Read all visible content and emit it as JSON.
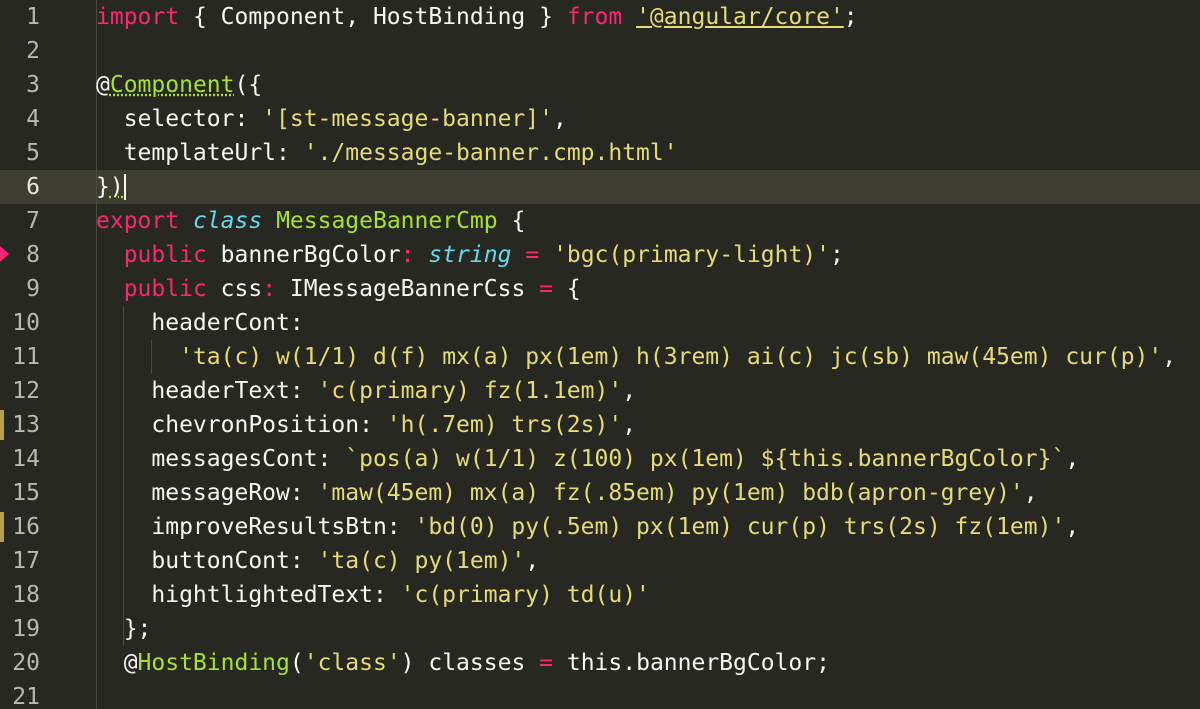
{
  "editor": {
    "colors": {
      "background": "#272822",
      "foreground": "#f8f8f2",
      "keyword": "#f92672",
      "function": "#a6e22e",
      "type": "#66d9ef",
      "string": "#e6db74",
      "gutter_number": "#b8b8b0",
      "current_line": "#3e3d32"
    },
    "current_line": 6,
    "modified_lines": [
      13,
      16
    ],
    "line_numbers": [
      "1",
      "2",
      "3",
      "4",
      "5",
      "6",
      "7",
      "8",
      "9",
      "10",
      "11",
      "12",
      "13",
      "14",
      "15",
      "16",
      "17",
      "18",
      "19",
      "20",
      "21"
    ],
    "lines": [
      {
        "tokens": [
          {
            "t": "import",
            "c": "kw"
          },
          {
            "t": " { Component, HostBinding } ",
            "c": ""
          },
          {
            "t": "from",
            "c": "kw"
          },
          {
            "t": " ",
            "c": ""
          },
          {
            "t": "'@angular/core'",
            "c": "st uline"
          },
          {
            "t": ";",
            "c": ""
          }
        ]
      },
      {
        "tokens": []
      },
      {
        "tokens": [
          {
            "t": "@",
            "c": ""
          },
          {
            "t": "Component",
            "c": "fn squiggle"
          },
          {
            "t": "({",
            "c": ""
          }
        ]
      },
      {
        "tokens": [
          {
            "t": "  selector: ",
            "c": ""
          },
          {
            "t": "'[st-message-banner]'",
            "c": "st"
          },
          {
            "t": ",",
            "c": ""
          }
        ]
      },
      {
        "tokens": [
          {
            "t": "  templateUrl: ",
            "c": ""
          },
          {
            "t": "'./message-banner.cmp.html'",
            "c": "st"
          }
        ]
      },
      {
        "tokens": [
          {
            "t": "}",
            "c": ""
          },
          {
            "t": ")",
            "c": "squiggle"
          }
        ]
      },
      {
        "tokens": [
          {
            "t": "export",
            "c": "kw"
          },
          {
            "t": " ",
            "c": ""
          },
          {
            "t": "class",
            "c": "ty"
          },
          {
            "t": " ",
            "c": ""
          },
          {
            "t": "MessageBannerCmp",
            "c": "fn"
          },
          {
            "t": " {",
            "c": ""
          }
        ]
      },
      {
        "tokens": [
          {
            "t": "  ",
            "c": ""
          },
          {
            "t": "public",
            "c": "kw"
          },
          {
            "t": " bannerBgColor",
            "c": ""
          },
          {
            "t": ":",
            "c": "kw"
          },
          {
            "t": " ",
            "c": ""
          },
          {
            "t": "string",
            "c": "ty"
          },
          {
            "t": " ",
            "c": ""
          },
          {
            "t": "=",
            "c": "kw"
          },
          {
            "t": " ",
            "c": ""
          },
          {
            "t": "'bgc(primary-light)'",
            "c": "st"
          },
          {
            "t": ";",
            "c": ""
          }
        ]
      },
      {
        "tokens": [
          {
            "t": "  ",
            "c": ""
          },
          {
            "t": "public",
            "c": "kw"
          },
          {
            "t": " css",
            "c": ""
          },
          {
            "t": ":",
            "c": "kw"
          },
          {
            "t": " IMessageBannerCss ",
            "c": ""
          },
          {
            "t": "=",
            "c": "kw"
          },
          {
            "t": " {",
            "c": ""
          }
        ]
      },
      {
        "tokens": [
          {
            "t": "    headerCont:",
            "c": ""
          }
        ]
      },
      {
        "tokens": [
          {
            "t": "      ",
            "c": ""
          },
          {
            "t": "'ta(c) w(1/1) d(f) mx(a) px(1em) h(3rem) ai(c) jc(sb) maw(45em) cur(p)'",
            "c": "st"
          },
          {
            "t": ",",
            "c": ""
          }
        ]
      },
      {
        "tokens": [
          {
            "t": "    headerText: ",
            "c": ""
          },
          {
            "t": "'c(primary) fz(1.1em)'",
            "c": "st"
          },
          {
            "t": ",",
            "c": ""
          }
        ]
      },
      {
        "tokens": [
          {
            "t": "    chevronPosition: ",
            "c": ""
          },
          {
            "t": "'h(.7em) trs(2s)'",
            "c": "st"
          },
          {
            "t": ",",
            "c": ""
          }
        ]
      },
      {
        "tokens": [
          {
            "t": "    messagesCont: ",
            "c": ""
          },
          {
            "t": "`pos(a) w(1/1) z(100) px(1em) ${this.bannerBgColor}`",
            "c": "st"
          },
          {
            "t": ",",
            "c": ""
          }
        ]
      },
      {
        "tokens": [
          {
            "t": "    messageRow: ",
            "c": ""
          },
          {
            "t": "'maw(45em) mx(a) fz(.85em) py(1em) bdb(apron-grey)'",
            "c": "st"
          },
          {
            "t": ",",
            "c": ""
          }
        ]
      },
      {
        "tokens": [
          {
            "t": "    improveResultsBtn: ",
            "c": ""
          },
          {
            "t": "'bd(0) py(.5em) px(1em) cur(p) trs(2s) fz(1em)'",
            "c": "st"
          },
          {
            "t": ",",
            "c": ""
          }
        ]
      },
      {
        "tokens": [
          {
            "t": "    buttonCont: ",
            "c": ""
          },
          {
            "t": "'ta(c) py(1em)'",
            "c": "st"
          },
          {
            "t": ",",
            "c": ""
          }
        ]
      },
      {
        "tokens": [
          {
            "t": "    hightlightedText: ",
            "c": ""
          },
          {
            "t": "'c(primary) td(u)'",
            "c": "st"
          }
        ]
      },
      {
        "tokens": [
          {
            "t": "  };",
            "c": ""
          }
        ]
      },
      {
        "tokens": [
          {
            "t": "  @",
            "c": ""
          },
          {
            "t": "HostBinding",
            "c": "fn"
          },
          {
            "t": "(",
            "c": ""
          },
          {
            "t": "'class'",
            "c": "st"
          },
          {
            "t": ") classes ",
            "c": ""
          },
          {
            "t": "=",
            "c": "kw"
          },
          {
            "t": " this.bannerBgColor;",
            "c": ""
          }
        ]
      },
      {
        "tokens": []
      }
    ]
  }
}
